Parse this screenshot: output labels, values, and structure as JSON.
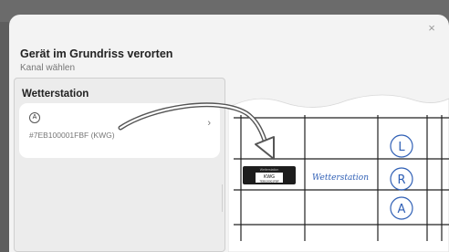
{
  "modal": {
    "close_symbol": "×",
    "title": "Gerät im Grundriss verorten",
    "subtitle": "Kanal wählen"
  },
  "panel": {
    "title": "Wetterstation",
    "channel": {
      "letter": "A",
      "serial": "#7EB100001FBF (KWG)",
      "chevron": "›"
    }
  },
  "illustration": {
    "device_small_label": "Wetterstation",
    "device_code": "KWG",
    "device_serial": "7EB100001FBF",
    "handwritten_label": "Wetterstation",
    "circle_letters": [
      "L",
      "R",
      "A"
    ]
  }
}
